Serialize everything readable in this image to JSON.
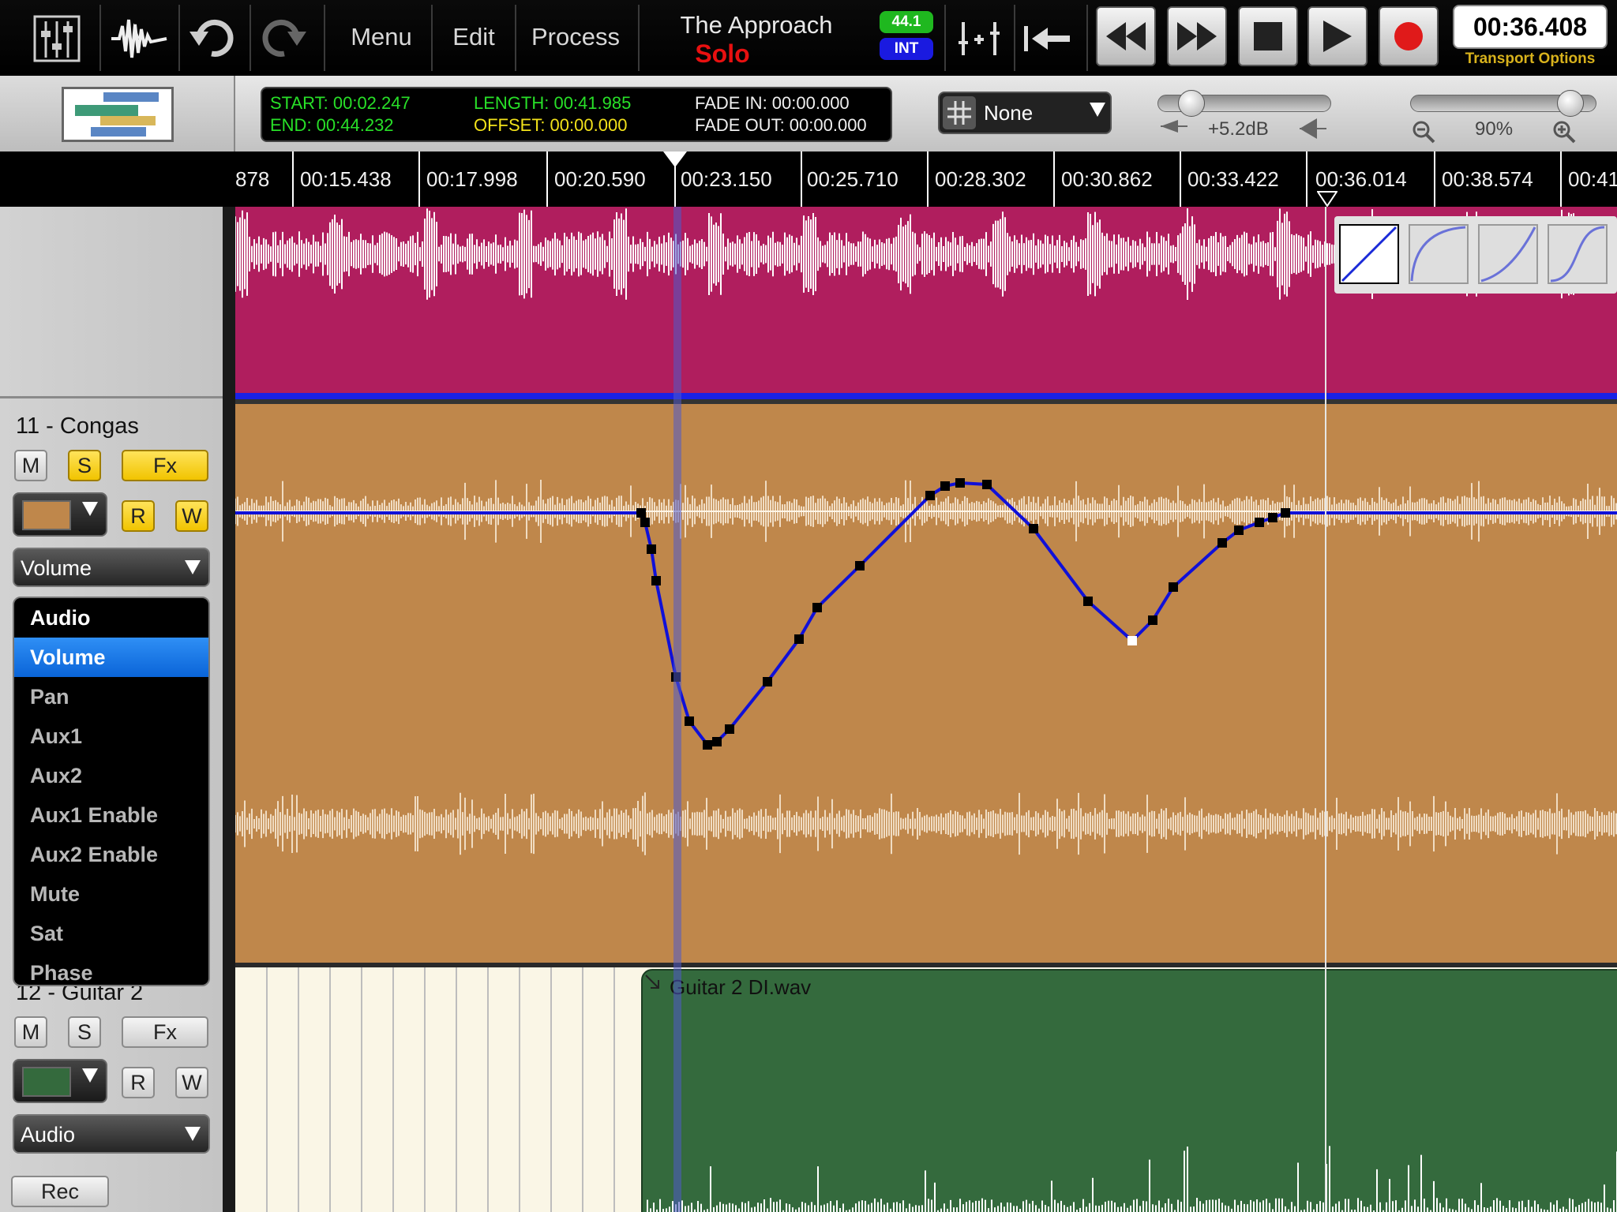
{
  "toolbar": {
    "menu_label": "Menu",
    "edit_label": "Edit",
    "process_label": "Process",
    "song_title": "The Approach",
    "mode_label": "Solo",
    "sample_rate": "44.1",
    "clock_source": "INT",
    "time_display": "00:36.408",
    "transport_options_label": "Transport Options",
    "colors": {
      "mode": "#e81010",
      "rate_badge": "#1fb81f",
      "int_badge": "#1a1ae0",
      "transport_options": "#d8b21c"
    }
  },
  "info": {
    "start_label": "START: 00:02.247",
    "end_label": "END: 00:44.232",
    "length_label": "LENGTH: 00:41.985",
    "offset_label": "OFFSET: 00:00.000",
    "fade_in_label": "FADE IN: 00:00.000",
    "fade_out_label": "FADE OUT: 00:00.000",
    "snap_value": "None",
    "gain_value": "+5.2dB",
    "zoom_value": "90%",
    "gain_level": 0.14,
    "zoom_level": 0.92
  },
  "ruler": {
    "labels": [
      "878",
      "00:15.438",
      "00:17.998",
      "00:20.590",
      "00:23.150",
      "00:25.710",
      "00:28.302",
      "00:30.862",
      "00:33.422",
      "00:36.014",
      "00:38.574",
      "00:41"
    ]
  },
  "tracks": [
    {
      "name": "11 - Congas",
      "mute": "M",
      "solo": "S",
      "fx": "Fx",
      "read": "R",
      "write": "W",
      "automation_selected": "Volume",
      "color": "#bf874b"
    },
    {
      "name": "12 - Guitar 2",
      "mute": "M",
      "solo": "S",
      "fx": "Fx",
      "read": "R",
      "write": "W",
      "automation_selected": "Audio",
      "color": "#346a3d",
      "rec_label": "Rec",
      "clip_name": "Guitar 2 DI.wav"
    }
  ],
  "dropdown": {
    "items": [
      "Audio",
      "Volume",
      "Pan",
      "Aux1",
      "Aux2",
      "Aux1 Enable",
      "Aux2 Enable",
      "Mute",
      "Sat",
      "Phase"
    ],
    "selected": "Volume"
  },
  "fades": [
    "linear",
    "log",
    "exp",
    "s-curve"
  ],
  "colors": {
    "automation": "#1010d8",
    "top_clip": "#b01e5e"
  }
}
